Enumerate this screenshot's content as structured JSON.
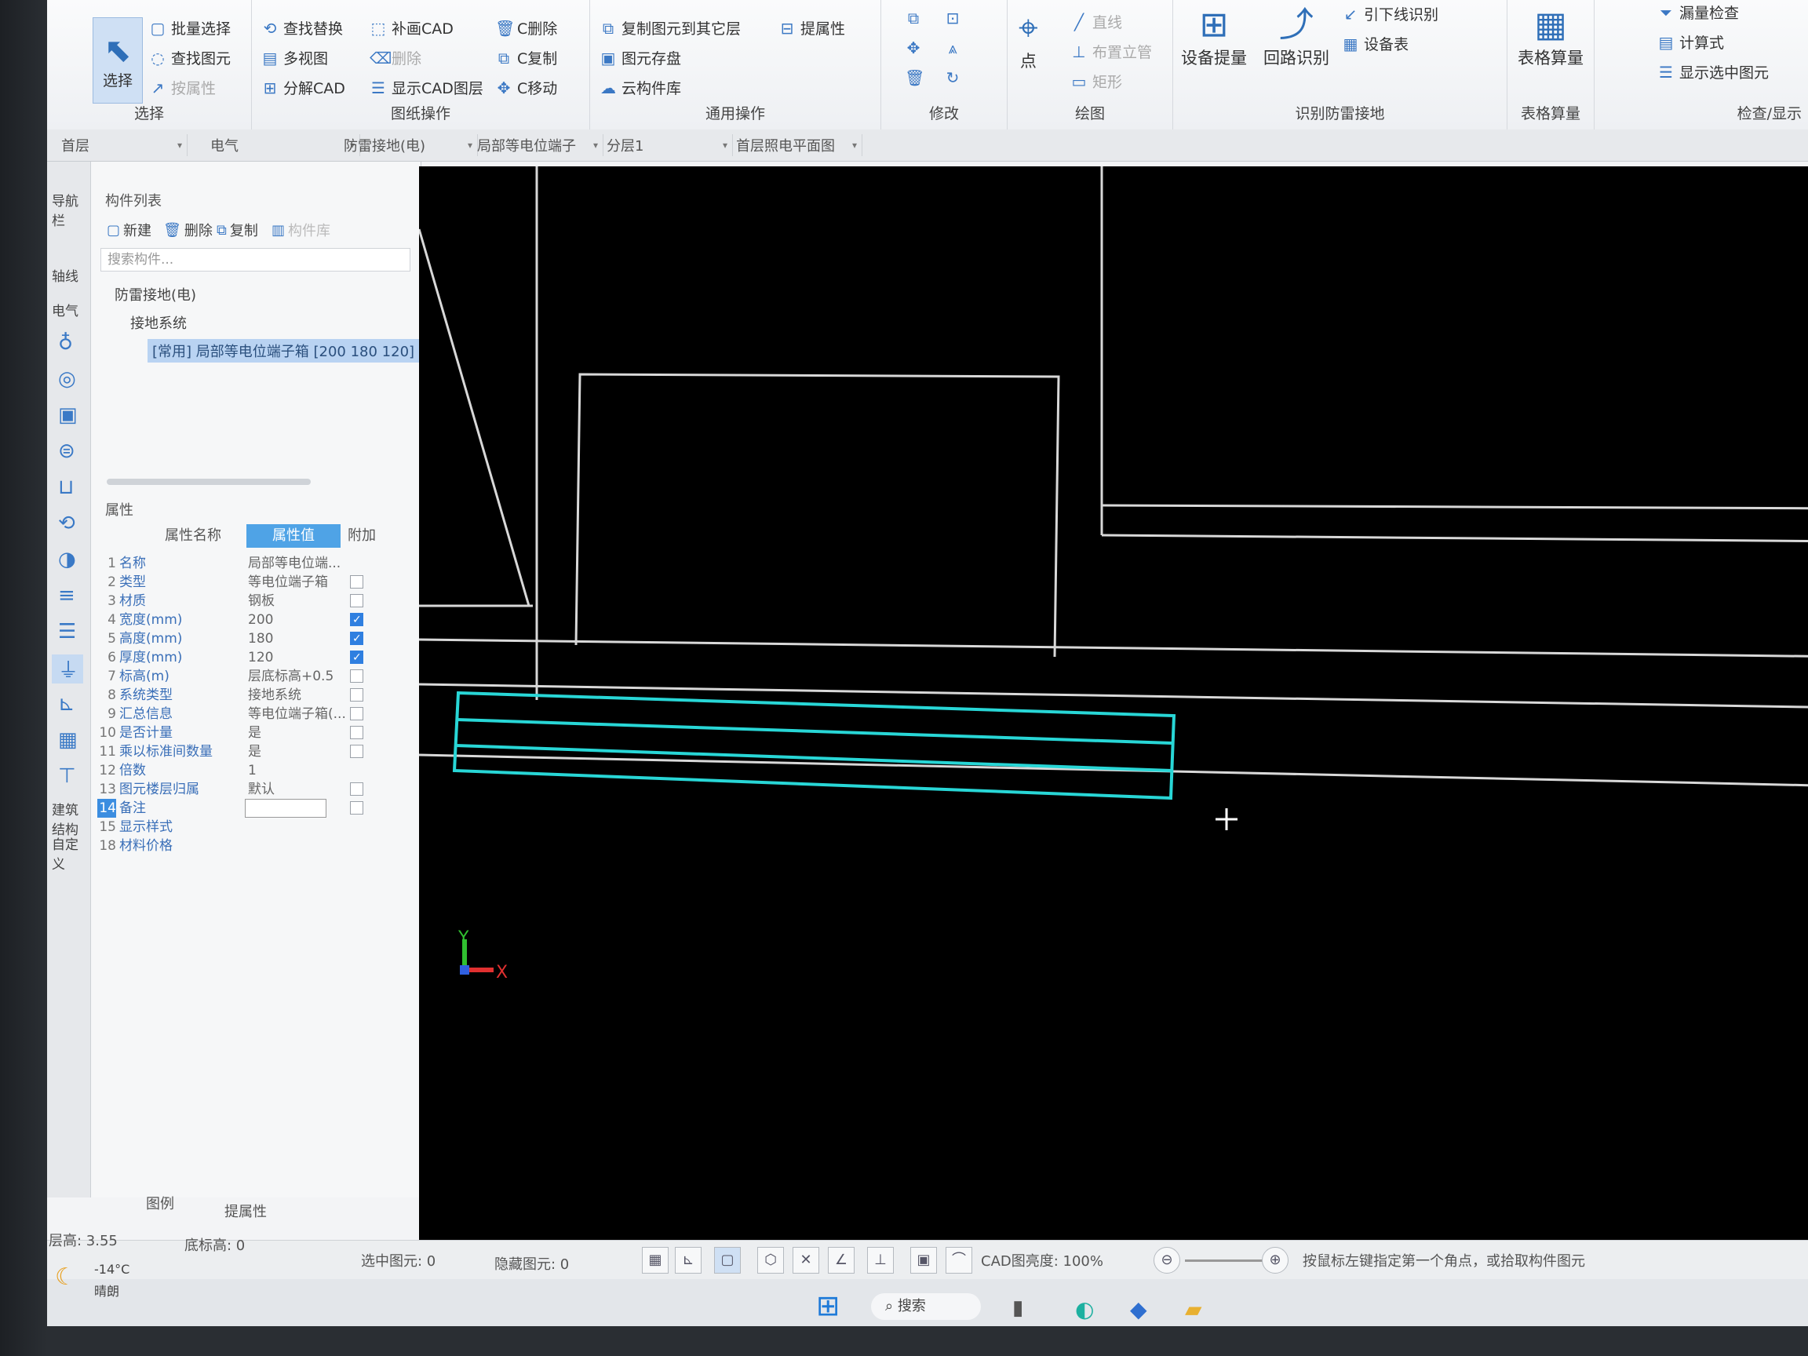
{
  "ribbon": {
    "select_group": {
      "button": "选择",
      "title": "选择",
      "items": [
        "批量选择",
        "查找图元",
        "按属性"
      ]
    },
    "drawing_ops": {
      "title": "图纸操作",
      "items": [
        "查找替换",
        "补画CAD",
        "多视图",
        "删除",
        "分解CAD",
        "显示CAD图层"
      ],
      "c_items": [
        "C删除",
        "C复制",
        "C移动"
      ]
    },
    "general_ops": {
      "title": "通用操作",
      "items": [
        "复制图元到其它层",
        "提属性",
        "图元存盘",
        "云构件库"
      ]
    },
    "modify": {
      "title": "修改"
    },
    "draw": {
      "title": "绘图",
      "point": "点",
      "items": [
        "直线",
        "布置立管",
        "矩形"
      ]
    },
    "identify": {
      "title": "识别防雷接地",
      "buttons": [
        "设备提量",
        "回路识别"
      ],
      "items": [
        "引下线识别",
        "设备表"
      ]
    },
    "table_calc": {
      "title": "表格算量",
      "button": "表格算量"
    },
    "check": {
      "title": "检查/显示",
      "items": [
        "漏量检查",
        "计算式",
        "显示选中图元"
      ]
    }
  },
  "filterbar": {
    "floor": "首层",
    "discipline": "电气",
    "category": "防雷接地(电)",
    "component_type": "局部等电位端子",
    "layer": "分层1",
    "drawing": "首层照电平面图"
  },
  "rail": {
    "nav_label": "导航栏",
    "axis": "轴线",
    "electric": "电气",
    "smart": "建筑结构",
    "custom": "自定义"
  },
  "component_list": {
    "title": "构件列表",
    "toolbar": [
      "新建",
      "删除",
      "复制",
      "构件库"
    ],
    "search_placeholder": "搜索构件...",
    "tree_root": "防雷接地(电)",
    "tree_child": "接地系统",
    "selected_item": "[常用] 局部等电位端子箱 [200 180 120]"
  },
  "properties": {
    "title": "属性",
    "headers": {
      "name": "属性名称",
      "value": "属性值",
      "add": "附加"
    },
    "rows": [
      {
        "num": "1",
        "name": "名称",
        "value": "局部等电位端..."
      },
      {
        "num": "2",
        "name": "类型",
        "value": "等电位端子箱"
      },
      {
        "num": "3",
        "name": "材质",
        "value": "钢板"
      },
      {
        "num": "4",
        "name": "宽度(mm)",
        "value": "200"
      },
      {
        "num": "5",
        "name": "高度(mm)",
        "value": "180"
      },
      {
        "num": "6",
        "name": "厚度(mm)",
        "value": "120"
      },
      {
        "num": "7",
        "name": "标高(m)",
        "value": "层底标高+0.5"
      },
      {
        "num": "8",
        "name": "系统类型",
        "value": "接地系统"
      },
      {
        "num": "9",
        "name": "汇总信息",
        "value": "等电位端子箱(..."
      },
      {
        "num": "10",
        "name": "是否计量",
        "value": "是"
      },
      {
        "num": "11",
        "name": "乘以标准间数量",
        "value": "是"
      },
      {
        "num": "12",
        "name": "倍数",
        "value": "1"
      },
      {
        "num": "13",
        "name": "图元楼层归属",
        "value": "默认"
      },
      {
        "num": "14",
        "name": "备注",
        "value": ""
      },
      {
        "num": "15",
        "name": "显示样式",
        "value": ""
      },
      {
        "num": "18",
        "name": "材料价格",
        "value": ""
      }
    ],
    "checked_rows": [
      4,
      5,
      6
    ],
    "tabs": [
      "图例",
      "提属性"
    ]
  },
  "status": {
    "floor_height": "层高: 3.55",
    "base_elev": "底标高: 0",
    "selected": "选中图元: 0",
    "hidden": "隐藏图元: 0",
    "cad_brightness": "CAD图亮度: 100%",
    "hint": "按鼠标左键指定第一个角点，或拾取构件图元"
  },
  "taskbar": {
    "weather_temp": "-14°C",
    "weather_desc": "晴朗",
    "search": "搜索"
  },
  "canvas": {
    "axis_x": "X",
    "axis_y": "Y",
    "highlight_color": "#28d6d6",
    "line_color": "#d8d8d8"
  }
}
